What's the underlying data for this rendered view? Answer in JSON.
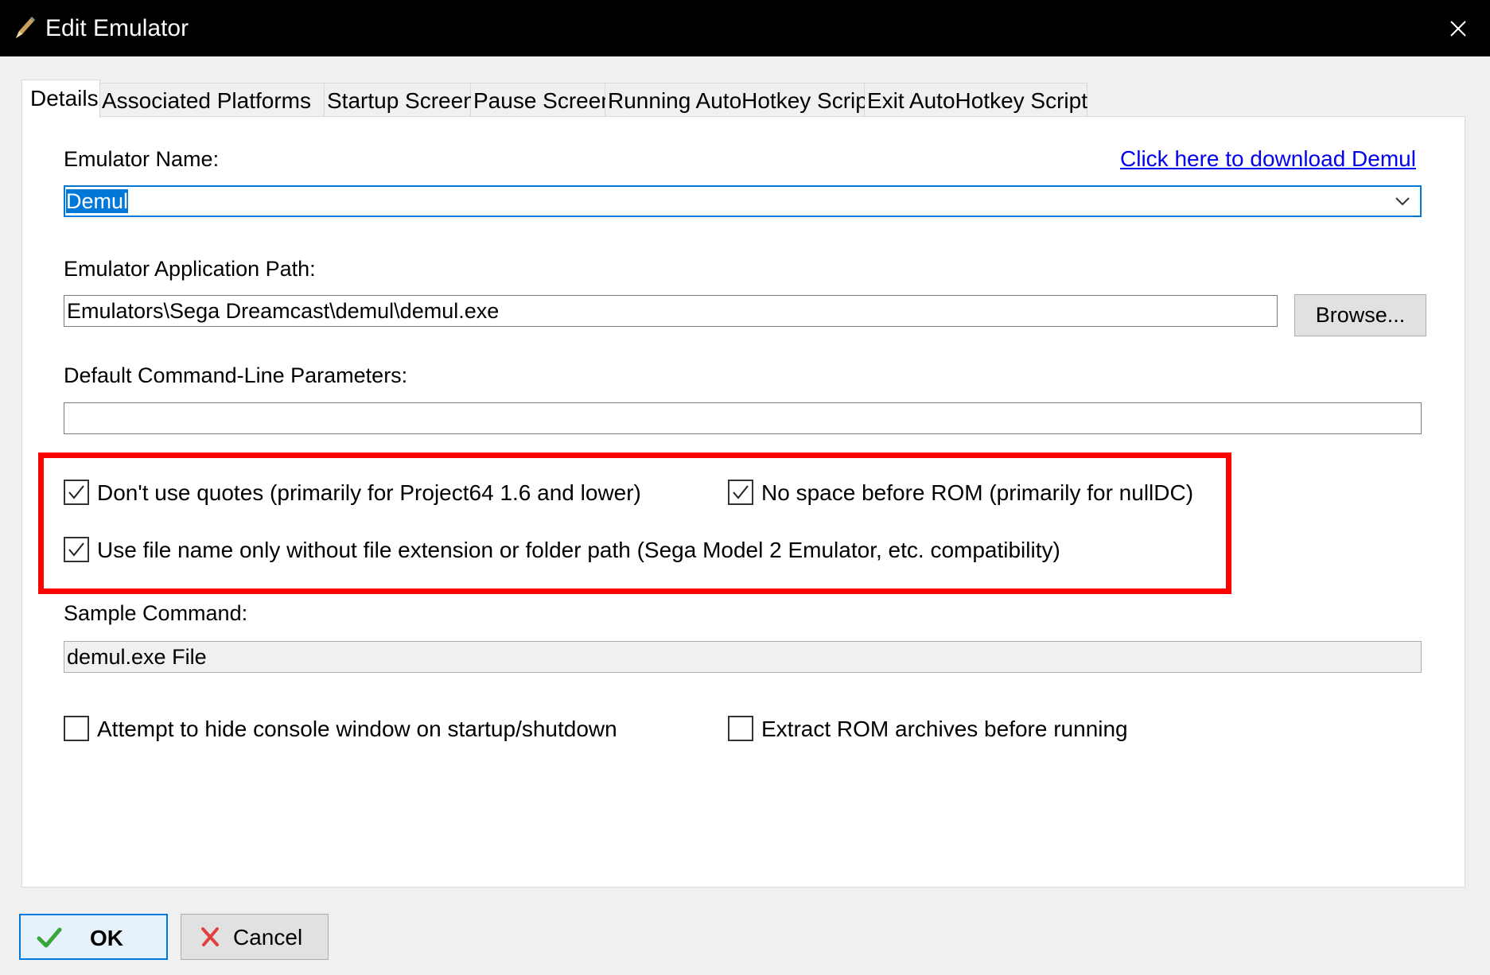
{
  "window": {
    "title": "Edit Emulator",
    "title_icon": "pencil-icon",
    "close_icon": "close-icon"
  },
  "tabs": [
    {
      "label": "Details",
      "active": true
    },
    {
      "label": "Associated Platforms",
      "active": false
    },
    {
      "label": "Startup Screen",
      "active": false
    },
    {
      "label": "Pause Screen",
      "active": false
    },
    {
      "label": "Running AutoHotkey Script",
      "active": false
    },
    {
      "label": "Exit AutoHotkey Script",
      "active": false
    }
  ],
  "details": {
    "emulator_name_label": "Emulator Name:",
    "emulator_name_value": "Demul",
    "download_link": "Click here to download Demul",
    "app_path_label": "Emulator Application Path:",
    "app_path_value": "Emulators\\Sega Dreamcast\\demul\\demul.exe",
    "browse_label": "Browse...",
    "params_label": "Default Command-Line Parameters:",
    "params_value": "",
    "options": {
      "dont_use_quotes": {
        "label": "Don't use quotes (primarily for Project64 1.6 and lower)",
        "checked": true
      },
      "no_space_before_rom": {
        "label": "No space before ROM (primarily for nullDC)",
        "checked": true
      },
      "file_name_only": {
        "label": "Use file name only without file extension or folder path (Sega Model 2 Emulator, etc. compatibility)",
        "checked": true
      }
    },
    "sample_command_label": "Sample Command:",
    "sample_command_value": "demul.exe File",
    "hide_console": {
      "label": "Attempt to hide console window on startup/shutdown",
      "checked": false
    },
    "extract_rom": {
      "label": "Extract ROM archives before running",
      "checked": false
    }
  },
  "footer": {
    "ok_label": "OK",
    "ok_icon": "checkmark-icon",
    "cancel_label": "Cancel",
    "cancel_icon": "x-icon"
  },
  "colors": {
    "titlebar": "#000000",
    "accent": "#0078d7",
    "highlight_border": "#ff0000",
    "link": "#0000ee",
    "ok_check": "#3aa53a",
    "cancel_x": "#e04040"
  }
}
